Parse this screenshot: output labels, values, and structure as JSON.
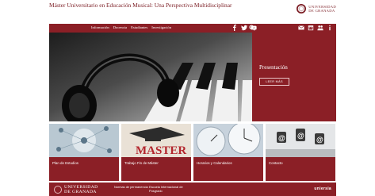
{
  "header": {
    "title": "Máster Universitario en Educación Musical: Una Perspectiva Multidisciplinar",
    "university_line1": "UNIVERSIDAD",
    "university_line2": "DE GRANADA"
  },
  "nav": {
    "links": [
      "Información",
      "Docencia",
      "Estudiantes",
      "Investigación"
    ],
    "social_icons": [
      "facebook-icon",
      "twitter-icon",
      "youtube-icon"
    ],
    "tool_icons": [
      "search-icon",
      "mail-icon",
      "calendar-icon",
      "users-icon",
      "info-icon"
    ]
  },
  "hero": {
    "title": "Presentación",
    "button": "LEER MÁS"
  },
  "tiles": [
    {
      "label": "Plan de Estudios",
      "image": "music-network-icons"
    },
    {
      "label": "Trabajo Fin de Máster",
      "image": "master-graduation-cap"
    },
    {
      "label": "Horarios y Calendarios",
      "image": "clocks"
    },
    {
      "label": "Contacto",
      "image": "chess-pieces-at-sign"
    }
  ],
  "footer": {
    "university": "UNIVERSIDAD",
    "university_line2": "DE GRANADA",
    "link1_line1": "Normas de permanencia",
    "link2_line1": "Escuela Internacional de",
    "link2_line2": "Posgrado",
    "brand": "uniersia"
  },
  "colors": {
    "brand": "#8b1f26",
    "dark_brand": "#7a1b22"
  }
}
